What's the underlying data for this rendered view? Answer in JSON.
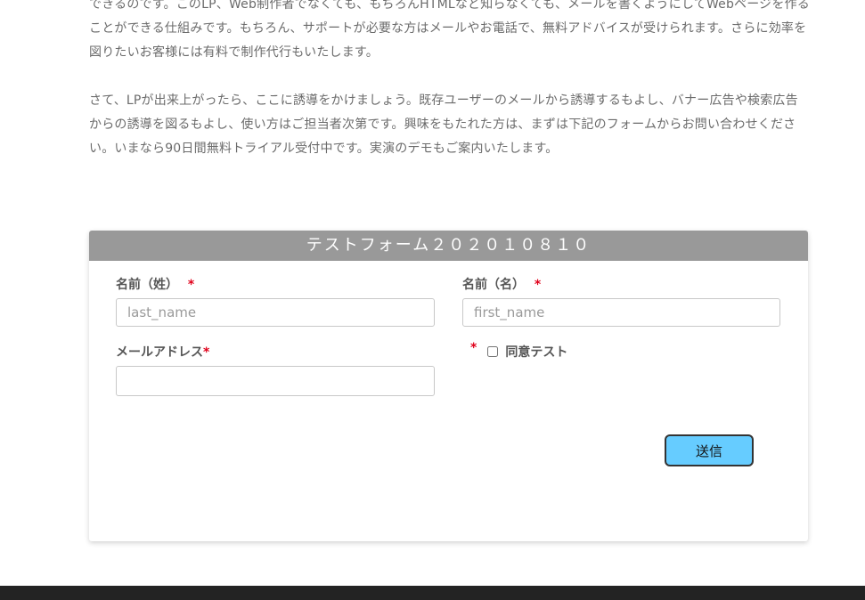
{
  "intro": {
    "paragraph1": "できるのです。このLP、Web制作者でなくても、もちろんHTMLなど知らなくても、メールを書くようにしてWebページを作ることができる仕組みです。もちろん、サポートが必要な方はメールやお電話で、無料アドバイスが受けられます。さらに効率を図りたいお客様には有料で制作代行もいたします。",
    "paragraph2": "さて、LPが出来上がったら、ここに誘導をかけましょう。既存ユーザーのメールから誘導するもよし、バナー広告や検索広告からの誘導を図るもよし、使い方はご担当者次第です。興味をもたれた方は、まずは下記のフォームからお問い合わせください。いまなら90日間無料トライアル受付中です。実演のデモもご案内いたします。"
  },
  "form": {
    "title": "テストフォーム２０２０１０８１０",
    "last_name_label": "名前（姓）",
    "last_name_placeholder": "last_name",
    "last_name_value": "",
    "first_name_label": "名前（名）",
    "first_name_placeholder": "first_name",
    "first_name_value": "",
    "email_label": "メールアドレス",
    "email_value": "",
    "consent_label": "同意テスト",
    "consent_checked": false,
    "required_mark": "*",
    "submit_label": "送信"
  },
  "colors": {
    "header_bg": "#999999",
    "submit_bg": "#66ccff",
    "required": "#e0001a",
    "footer_bg": "#232323"
  }
}
